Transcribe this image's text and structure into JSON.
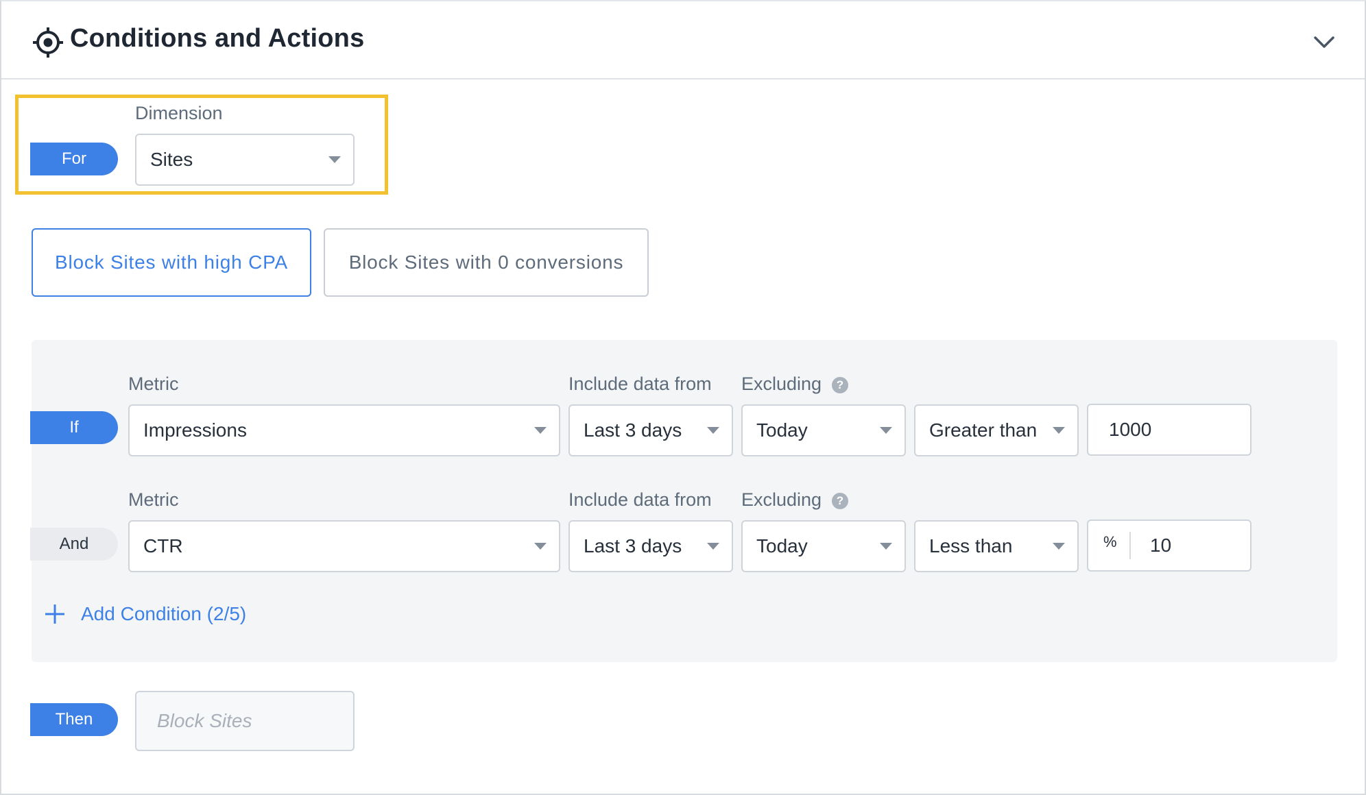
{
  "header": {
    "title": "Conditions and Actions",
    "icon": "target-icon",
    "collapse_icon": "chevron-down-icon"
  },
  "for_section": {
    "pill_label": "For",
    "dimension_label": "Dimension",
    "dimension_value": "Sites"
  },
  "presets": [
    {
      "label": "Block Sites with high CPA",
      "active": true
    },
    {
      "label": "Block Sites with 0 conversions",
      "active": false
    }
  ],
  "conditions": [
    {
      "pill_label": "If",
      "metric_label": "Metric",
      "metric_value": "Impressions",
      "include_label": "Include data from",
      "include_value": "Last 3 days",
      "excluding_label": "Excluding",
      "excluding_value": "Today",
      "operator_value": "Greater than",
      "threshold_value": "1000"
    },
    {
      "pill_label": "And",
      "metric_label": "Metric",
      "metric_value": "CTR",
      "include_label": "Include data from",
      "include_value": "Last 3 days",
      "excluding_label": "Excluding",
      "excluding_value": "Today",
      "operator_value": "Less than",
      "threshold_prefix": "%",
      "threshold_value": "10"
    }
  ],
  "help_glyph": "?",
  "add_condition_label": "Add Condition (2/5)",
  "then_section": {
    "pill_label": "Then",
    "action_placeholder": "Block Sites"
  },
  "colors": {
    "accent": "#3d80e6",
    "highlight": "#f3c130",
    "panel_bg": "#f4f5f7"
  }
}
